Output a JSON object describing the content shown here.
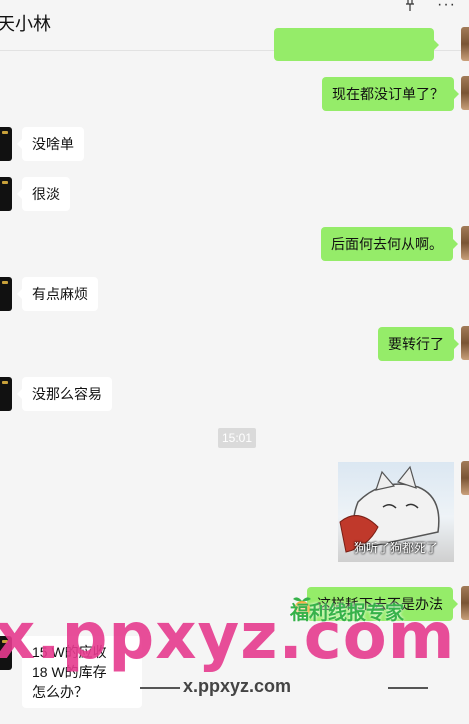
{
  "header": {
    "title": "天小林",
    "pin_icon": "pin-icon",
    "more_icon": "more-icon",
    "more_glyph": "···"
  },
  "messages": [
    {
      "id": "m0",
      "from": "me",
      "text": ""
    },
    {
      "id": "m1",
      "from": "me",
      "text": "现在都没订单了？"
    },
    {
      "id": "m2",
      "from": "other",
      "text": "没啥单"
    },
    {
      "id": "m3",
      "from": "other",
      "text": "很淡"
    },
    {
      "id": "m4",
      "from": "me",
      "text": "后面何去何从啊。"
    },
    {
      "id": "m5",
      "from": "other",
      "text": "有点麻烦"
    },
    {
      "id": "m6",
      "from": "me",
      "text": "要转行了"
    },
    {
      "id": "m7",
      "from": "other",
      "text": "没那么容易"
    },
    {
      "id": "m8",
      "from": "me",
      "type": "sticker",
      "caption": "狗听了狗都死了"
    },
    {
      "id": "m9",
      "from": "me",
      "text": "这样耗下去不是办法"
    },
    {
      "id": "m10",
      "from": "other",
      "lines": [
        "15 W的应收",
        "18 W的库存",
        "怎么办？"
      ]
    }
  ],
  "timestamp": "15:01",
  "watermarks": {
    "main": "x.ppxyz.com",
    "sub": "x.ppxyz.com",
    "brand": "福利线报专家"
  },
  "colors": {
    "outgoing_bubble": "#95ec69",
    "incoming_bubble": "#ffffff",
    "background": "#f5f5f5",
    "watermark": "#e63b8f"
  }
}
